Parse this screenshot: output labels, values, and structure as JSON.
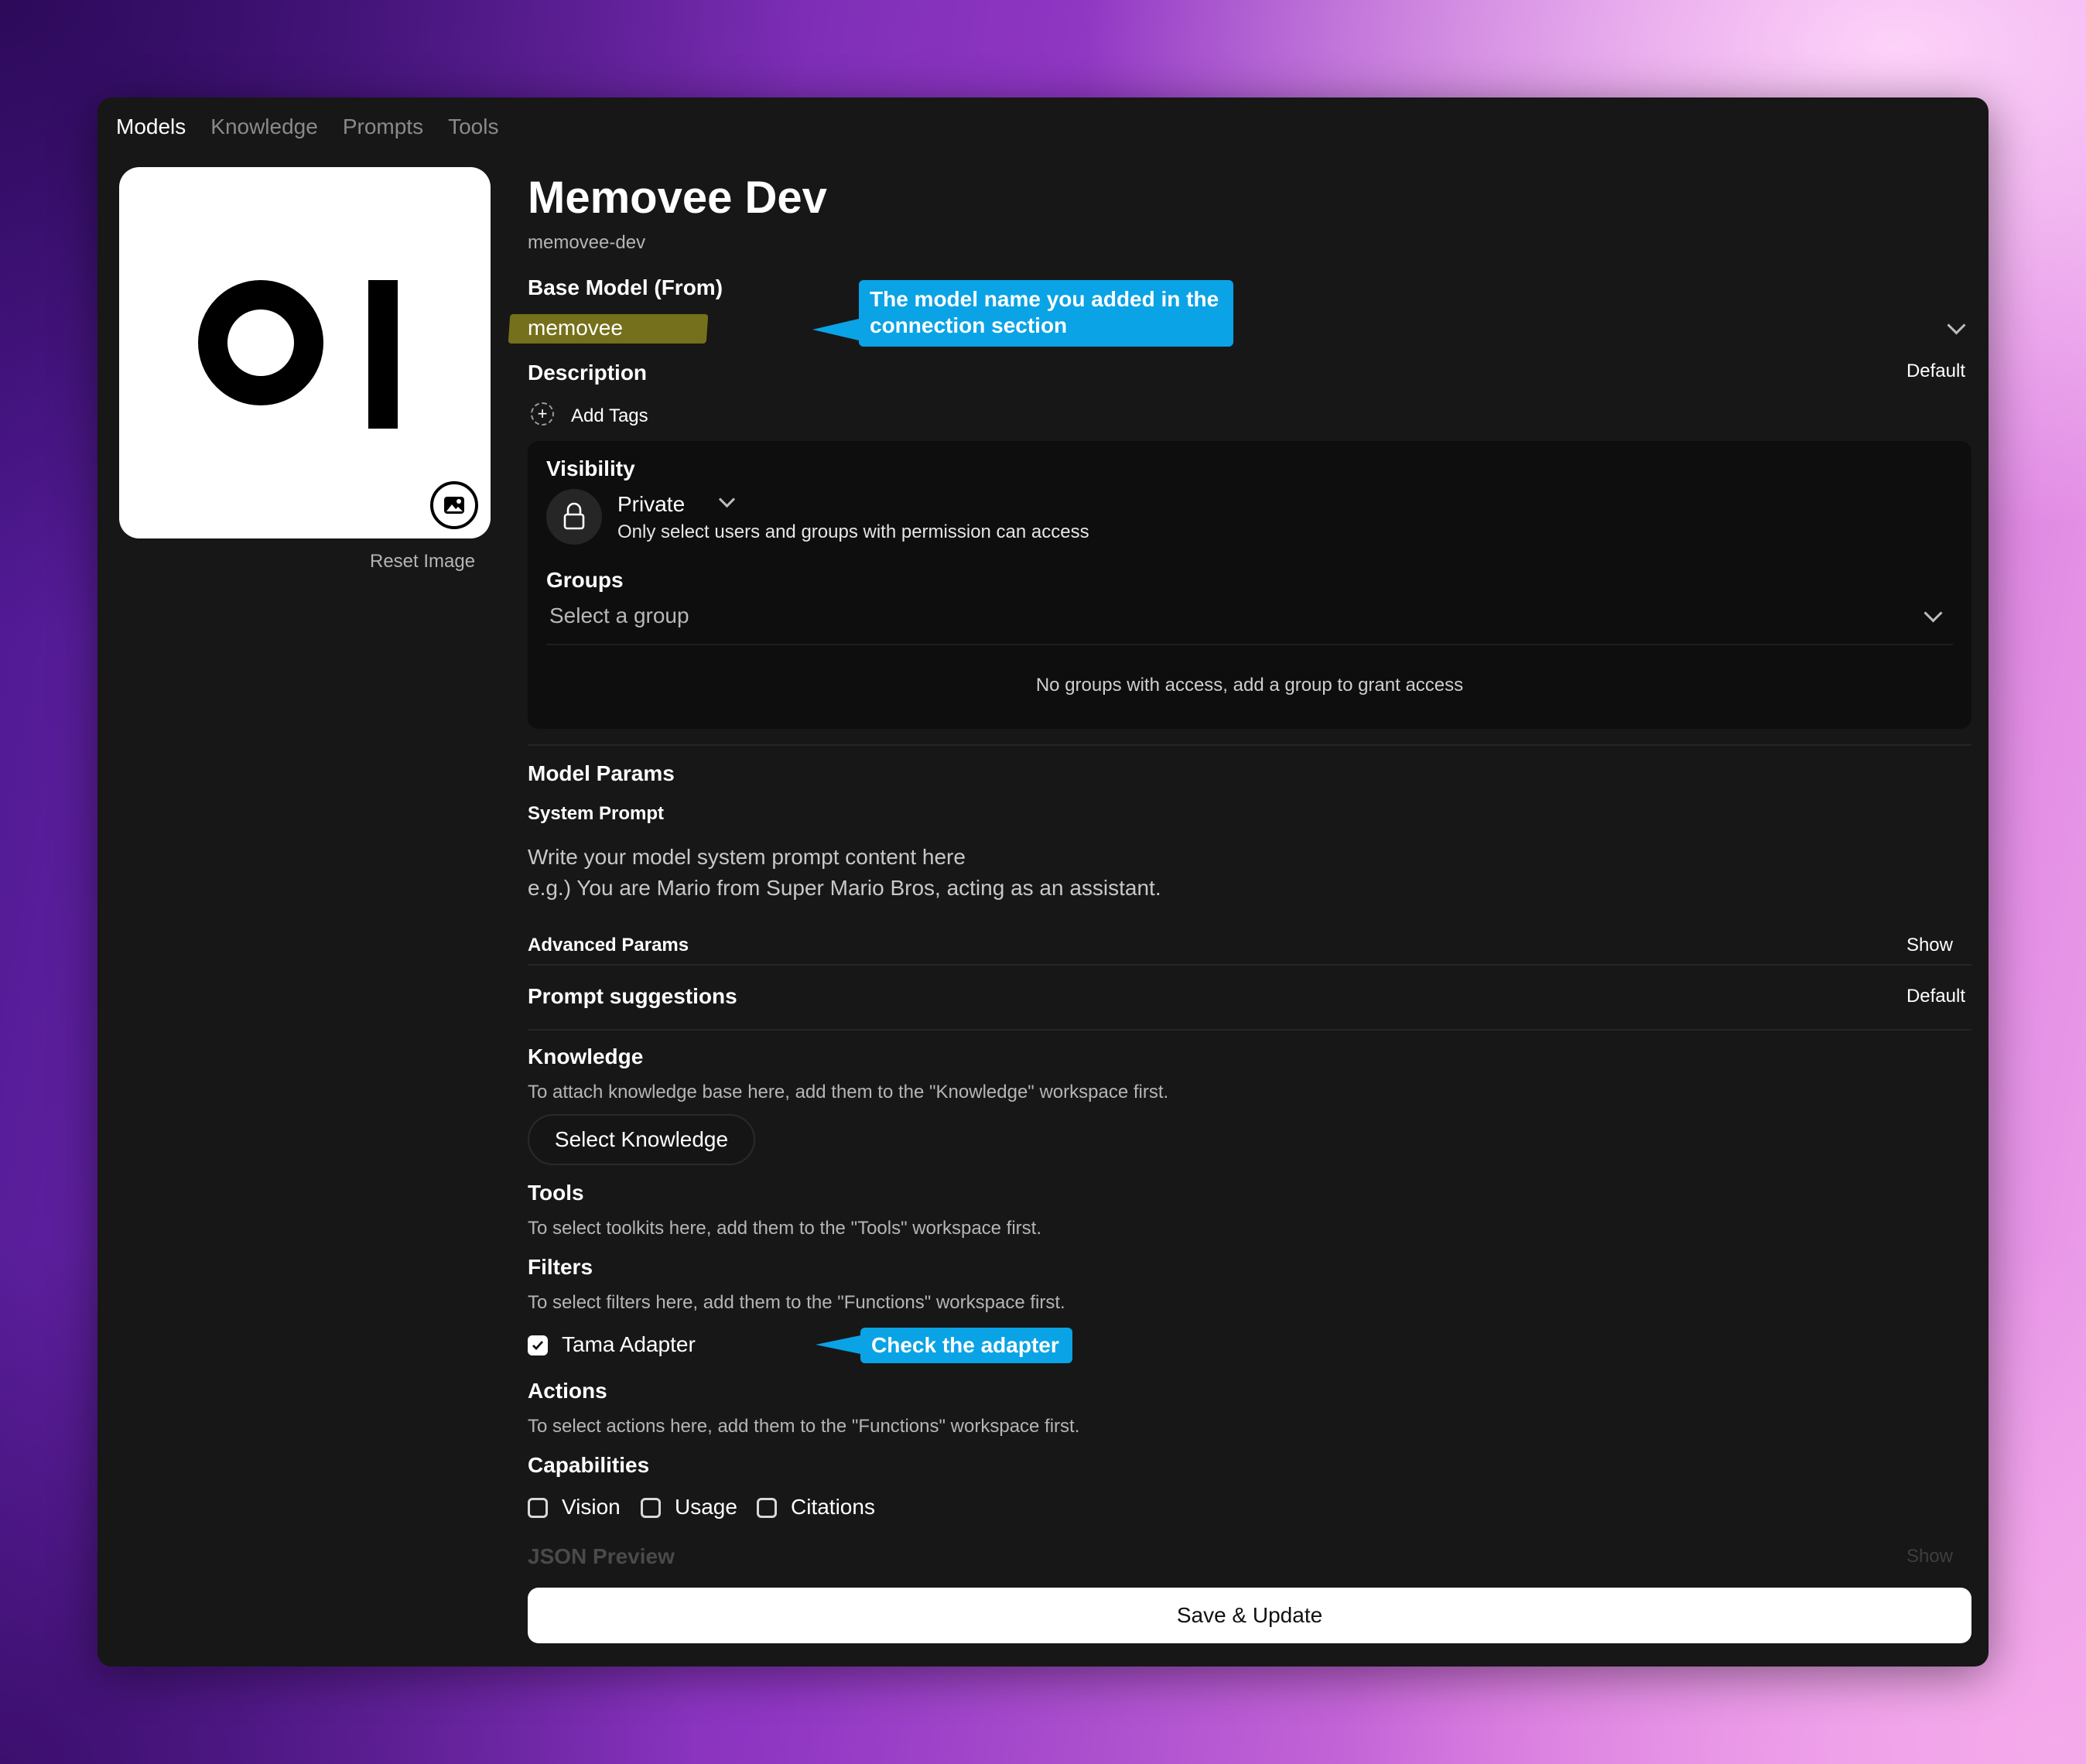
{
  "nav": {
    "tabs": [
      "Models",
      "Knowledge",
      "Prompts",
      "Tools"
    ],
    "active": "Models"
  },
  "avatar": {
    "logo_text": "OI",
    "reset_label": "Reset Image"
  },
  "model": {
    "name": "Memovee Dev",
    "id": "memovee-dev"
  },
  "base_model": {
    "label": "Base Model (From)",
    "value": "memovee"
  },
  "callouts": {
    "base_model_line1": "The model name you added in the",
    "base_model_line2": "connection section",
    "adapter": "Check the adapter"
  },
  "description": {
    "label": "Description",
    "action": "Default"
  },
  "tags": {
    "add_label": "Add Tags"
  },
  "visibility": {
    "label": "Visibility",
    "value": "Private",
    "help": "Only select users and groups with permission can access"
  },
  "groups": {
    "label": "Groups",
    "placeholder": "Select a group",
    "empty": "No groups with access, add a group to grant access"
  },
  "model_params": {
    "label": "Model Params",
    "system_prompt_label": "System Prompt",
    "system_prompt_line1": "Write your model system prompt content here",
    "system_prompt_line2": "e.g.) You are Mario from Super Mario Bros, acting as an assistant.",
    "advanced_label": "Advanced Params",
    "advanced_action": "Show"
  },
  "prompt_suggestions": {
    "label": "Prompt suggestions",
    "action": "Default"
  },
  "knowledge": {
    "label": "Knowledge",
    "help": "To attach knowledge base here, add them to the \"Knowledge\" workspace first.",
    "button": "Select Knowledge"
  },
  "tools": {
    "label": "Tools",
    "help": "To select toolkits here, add them to the \"Tools\" workspace first."
  },
  "filters": {
    "label": "Filters",
    "help": "To select filters here, add them to the \"Functions\" workspace first.",
    "items": [
      {
        "name": "Tama Adapter",
        "checked": true
      }
    ]
  },
  "actions": {
    "label": "Actions",
    "help": "To select actions here, add them to the \"Functions\" workspace first."
  },
  "capabilities": {
    "label": "Capabilities",
    "items": [
      {
        "name": "Vision",
        "checked": false
      },
      {
        "name": "Usage",
        "checked": false
      },
      {
        "name": "Citations",
        "checked": false
      }
    ]
  },
  "json_preview": {
    "label": "JSON Preview",
    "action": "Show"
  },
  "save_label": "Save & Update",
  "colors": {
    "callout": "#0aa3e6",
    "highlight": "#75701b",
    "window_bg": "#171717"
  }
}
